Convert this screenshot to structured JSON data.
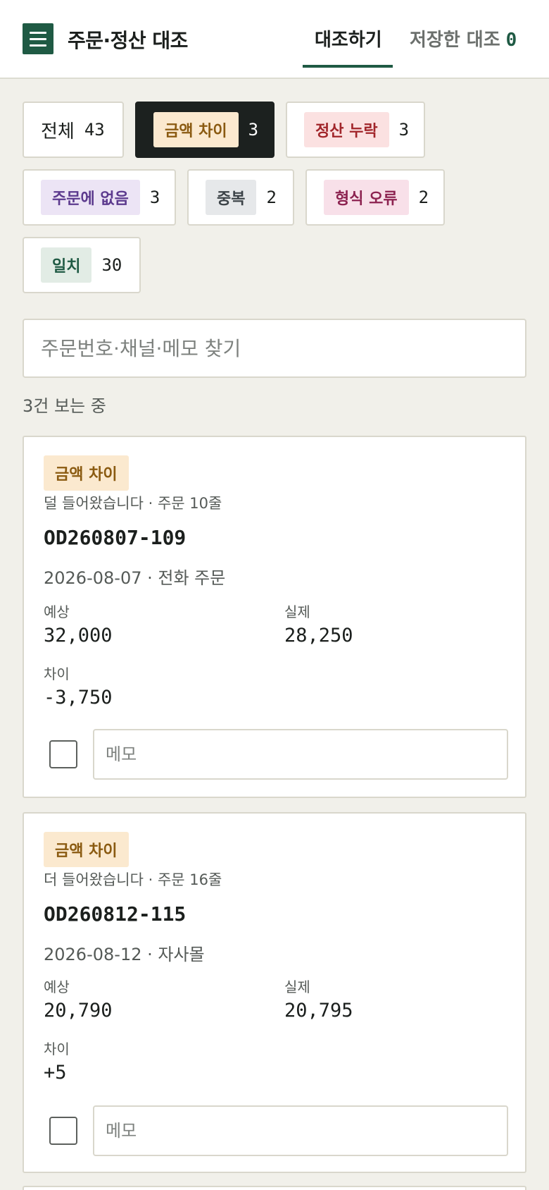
{
  "header": {
    "title": "주문·정산 대조",
    "tabs": [
      {
        "label": "대조하기",
        "active": true
      },
      {
        "label": "저장한 대조",
        "count": "0",
        "active": false
      }
    ]
  },
  "filters": [
    {
      "label": "전체",
      "count": "43",
      "type": "plain",
      "active": false
    },
    {
      "label": "금액 차이",
      "count": "3",
      "type": "amount",
      "active": true
    },
    {
      "label": "정산 누락",
      "count": "3",
      "type": "missing",
      "active": false
    },
    {
      "label": "주문에 없음",
      "count": "3",
      "type": "notorder",
      "active": false
    },
    {
      "label": "중복",
      "count": "2",
      "type": "dup",
      "active": false
    },
    {
      "label": "형식 오류",
      "count": "2",
      "type": "format",
      "active": false
    },
    {
      "label": "일치",
      "count": "30",
      "type": "match",
      "active": false
    }
  ],
  "search": {
    "placeholder": "주문번호·채널·메모 찾기",
    "value": ""
  },
  "result_count": "3건 보는 중",
  "labels": {
    "expected": "예상",
    "actual": "실제",
    "diff": "차이",
    "memo_placeholder": "메모"
  },
  "cards": [
    {
      "badge": "금액 차이",
      "desc": "덜 들어왔습니다 · 주문 10줄",
      "order_no": "OD260807-109",
      "meta": "2026-08-07 · 전화 주문",
      "expected": "32,000",
      "actual": "28,250",
      "diff": "-3,750",
      "checked": false,
      "memo": ""
    },
    {
      "badge": "금액 차이",
      "desc": "더 들어왔습니다 · 주문 16줄",
      "order_no": "OD260812-115",
      "meta": "2026-08-12 · 자사몰",
      "expected": "20,790",
      "actual": "20,795",
      "diff": "+5",
      "checked": false,
      "memo": ""
    }
  ],
  "colors": {
    "accent": "#1f5a44",
    "background": "#f1f0ea",
    "active_chip": "#1c211f"
  },
  "icons": {
    "menu": "hamburger-menu-icon"
  }
}
